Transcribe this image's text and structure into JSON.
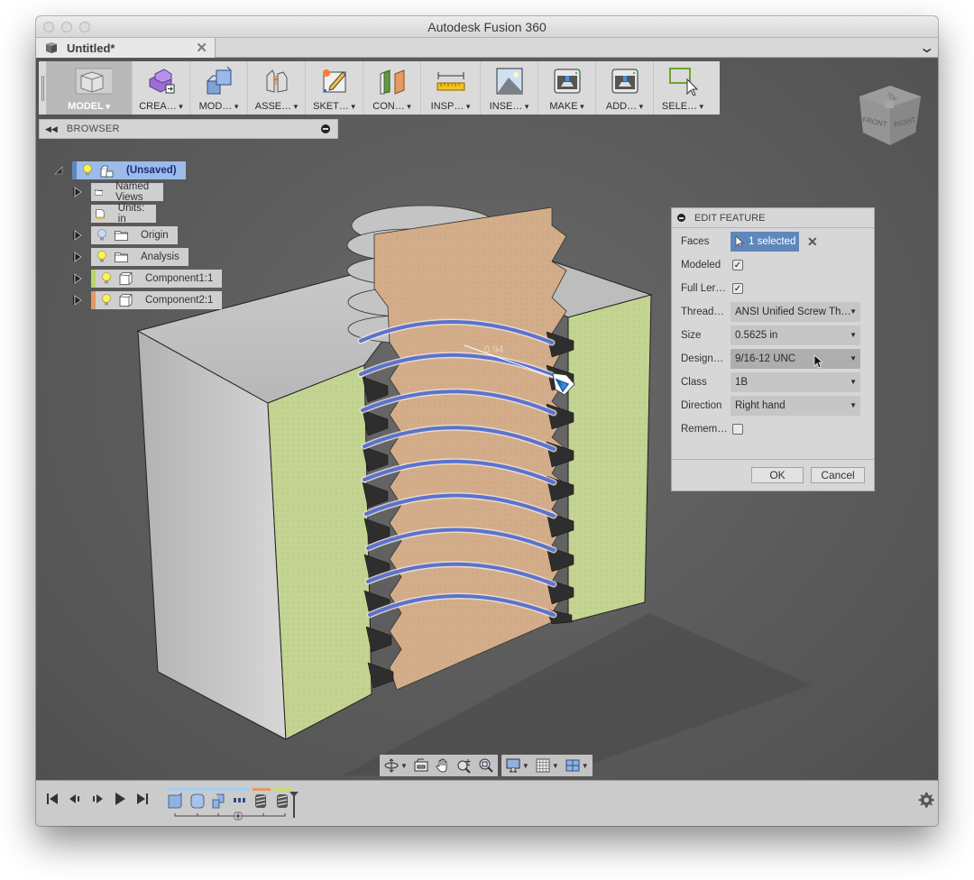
{
  "window": {
    "title": "Autodesk Fusion 360",
    "tab": {
      "label": "Untitled*",
      "close": "✕"
    },
    "tab_overflow": "chevron-down"
  },
  "toolbar": {
    "workspace": "MODEL",
    "tools": [
      {
        "id": "create",
        "label": "CREA…",
        "icon": "create-icon"
      },
      {
        "id": "modify",
        "label": "MOD…",
        "icon": "modify-icon"
      },
      {
        "id": "assemble",
        "label": "ASSE…",
        "icon": "assemble-icon"
      },
      {
        "id": "sketch",
        "label": "SKET…",
        "icon": "sketch-icon"
      },
      {
        "id": "construct",
        "label": "CON…",
        "icon": "construct-icon"
      },
      {
        "id": "inspect",
        "label": "INSP…",
        "icon": "inspect-ruler-icon"
      },
      {
        "id": "insert",
        "label": "INSE…",
        "icon": "insert-image-icon"
      },
      {
        "id": "make",
        "label": "MAKE",
        "icon": "make-3dprint-icon"
      },
      {
        "id": "addins",
        "label": "ADD…",
        "icon": "addins-icon"
      },
      {
        "id": "select",
        "label": "SELE…",
        "icon": "select-window-icon"
      }
    ]
  },
  "browser": {
    "title": "BROWSER",
    "root": {
      "label": "(Unsaved)"
    },
    "items": [
      {
        "label": "Named Views",
        "expandable": true,
        "bulb": false,
        "icon": "folder"
      },
      {
        "label": "Units: in",
        "expandable": false,
        "bulb": false,
        "icon": "units-doc"
      },
      {
        "label": "Origin",
        "expandable": true,
        "bulb": "off",
        "icon": "folder"
      },
      {
        "label": "Analysis",
        "expandable": true,
        "bulb": "on",
        "icon": "folder"
      },
      {
        "label": "Component1:1",
        "expandable": true,
        "bulb": "on",
        "icon": "component",
        "accent": "#b8d66b"
      },
      {
        "label": "Component2:1",
        "expandable": true,
        "bulb": "on",
        "icon": "component",
        "accent": "#e29a63"
      }
    ]
  },
  "viewcube": {
    "faces": [
      "FRONT",
      "RIGHT",
      "TOP"
    ]
  },
  "edit_feature": {
    "title": "EDIT FEATURE",
    "faces": {
      "label": "Faces",
      "value": "1 selected"
    },
    "modeled": {
      "label": "Modeled",
      "checked": true
    },
    "full_length": {
      "label": "Full Ler…",
      "checked": true
    },
    "thread_type": {
      "label": "Thread…",
      "value": "ANSI Unified Screw Th…"
    },
    "size": {
      "label": "Size",
      "value": "0.5625 in"
    },
    "designation": {
      "label": "Design…",
      "value": "9/16-12 UNC"
    },
    "class": {
      "label": "Class",
      "value": "1B"
    },
    "direction": {
      "label": "Direction",
      "value": "Right hand"
    },
    "remember": {
      "label": "Remem…",
      "checked": false
    },
    "ok": "OK",
    "cancel": "Cancel",
    "check_mark": "✓"
  },
  "viewport": {
    "dimension_label": "0.94"
  },
  "timeline": {
    "features": [
      "extrude",
      "cylinder",
      "combine",
      "pattern",
      "thread",
      "thread"
    ],
    "groups": [
      {
        "color": "#9fd0f2",
        "span": 4
      },
      {
        "color": "#e59a5f",
        "span": 1
      },
      {
        "color": "#c4e06b",
        "span": 1
      }
    ]
  },
  "colors": {
    "accent_blue": "#5f87bb",
    "browser_root_highlight": "#9bbbe9",
    "section_green": "#c2d28f",
    "section_tan": "#d2ab87",
    "thread_blue": "#5b72cf"
  }
}
